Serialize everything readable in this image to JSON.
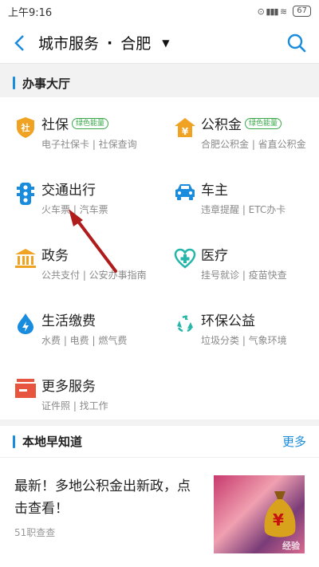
{
  "status_bar": {
    "time": "上午9:16",
    "battery": "67"
  },
  "header": {
    "title": "城市服务",
    "separator": "·",
    "city": "合肥"
  },
  "service_section": {
    "title": "办事大厅",
    "items": [
      {
        "name": "社保",
        "badge": "绿色能量",
        "sub": "电子社保卡 | 社保查询",
        "icon": "shield-icon",
        "color": "#f0a323"
      },
      {
        "name": "公积金",
        "badge": "绿色能量",
        "sub": "合肥公积金 | 省直公积金",
        "icon": "yuan-house-icon",
        "color": "#f0a323"
      },
      {
        "name": "交通出行",
        "badge": "",
        "sub": "火车票 | 汽车票",
        "icon": "traffic-light-icon",
        "color": "#1a8cde"
      },
      {
        "name": "车主",
        "badge": "",
        "sub": "违章提醒 | ETC办卡",
        "icon": "car-icon",
        "color": "#1a8cde"
      },
      {
        "name": "政务",
        "badge": "",
        "sub": "公共支付 | 公安办事指南",
        "icon": "government-icon",
        "color": "#f0a323"
      },
      {
        "name": "医疗",
        "badge": "",
        "sub": "挂号就诊 | 疫苗快查",
        "icon": "medical-icon",
        "color": "#24b6a8"
      },
      {
        "name": "生活缴费",
        "badge": "",
        "sub": "水费 | 电费 | 燃气费",
        "icon": "water-drop-icon",
        "color": "#1a8cde"
      },
      {
        "name": "环保公益",
        "badge": "",
        "sub": "垃圾分类 | 气象环境",
        "icon": "recycle-icon",
        "color": "#24b6a8"
      },
      {
        "name": "更多服务",
        "badge": "",
        "sub": "证件照 | 找工作",
        "icon": "more-box-icon",
        "color": "#e8553e"
      }
    ]
  },
  "news_section": {
    "title": "本地早知道",
    "more": "更多",
    "item": {
      "title": "最新！多地公积金出新政，点击查看！",
      "source": "51职查查",
      "thumb_mark": "¥",
      "watermark": "经验"
    }
  }
}
